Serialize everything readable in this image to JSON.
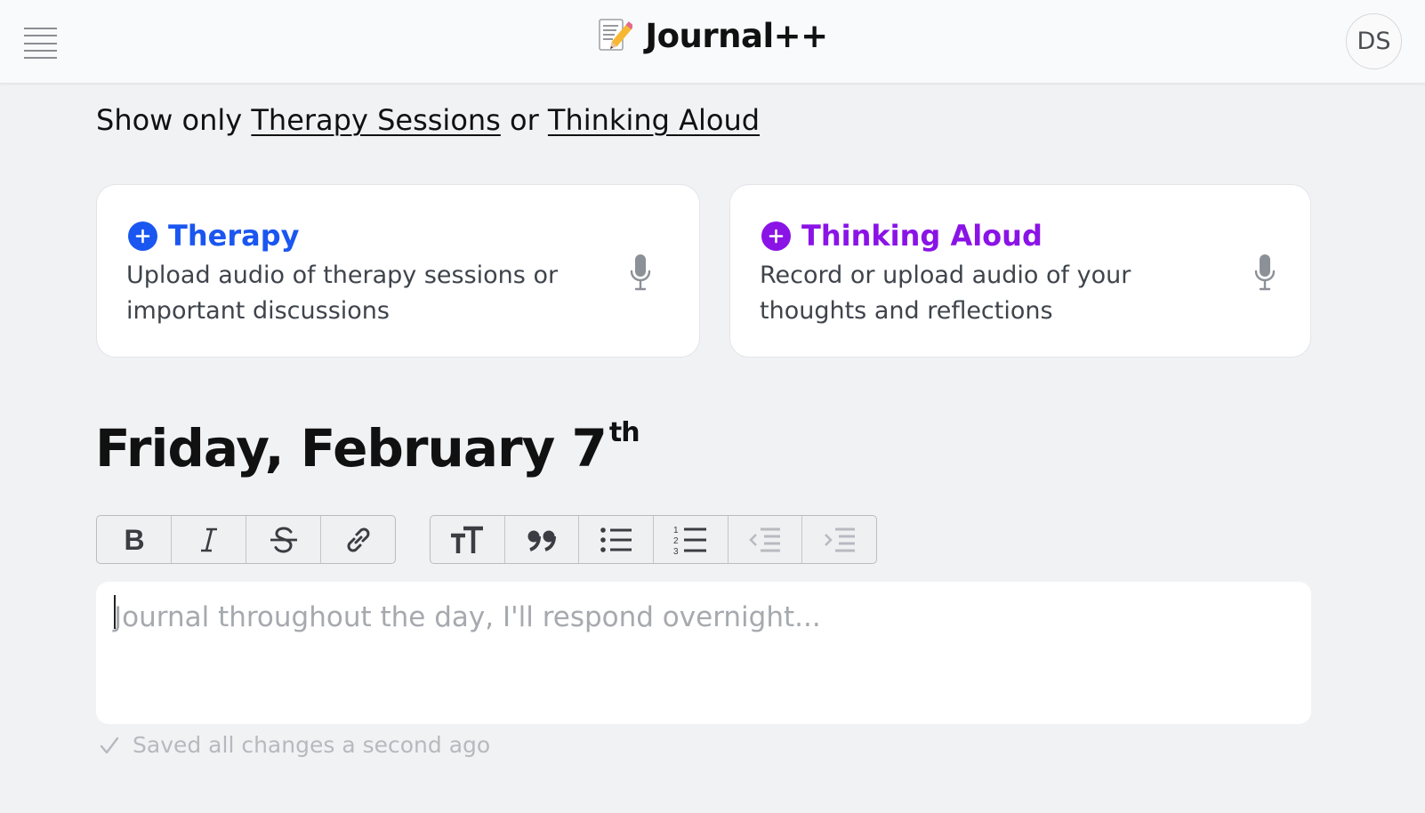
{
  "header": {
    "brand_emoji": "📝",
    "brand_title": "Journal++",
    "avatar_initials": "DS",
    "menu_icon": "hamburger-menu-icon"
  },
  "filter": {
    "prefix": "Show only",
    "link_therapy": "Therapy Sessions",
    "joiner": "or",
    "link_thinking": "Thinking Aloud"
  },
  "cards": [
    {
      "title": "Therapy",
      "description": "Upload audio of therapy sessions or important discussions",
      "accent": "#1a56f0",
      "icons": [
        "plus-circle-icon",
        "microphone-icon"
      ]
    },
    {
      "title": "Thinking Aloud",
      "description": "Record or upload audio of your thoughts and reflections",
      "accent": "#8a13e6",
      "icons": [
        "plus-circle-icon",
        "microphone-icon"
      ]
    }
  ],
  "date": {
    "text": "Friday, February 7",
    "suffix": "th"
  },
  "toolbar": {
    "groups": [
      [
        "bold-icon",
        "italic-icon",
        "strikethrough-icon",
        "link-icon"
      ],
      [
        "heading-icon",
        "quote-icon",
        "bullet-list-icon",
        "numbered-list-icon",
        "outdent-icon",
        "indent-icon"
      ]
    ],
    "disabled": [
      "outdent-icon",
      "indent-icon"
    ]
  },
  "editor": {
    "placeholder": "Journal throughout the day, I'll respond overnight..."
  },
  "status": {
    "saved_text": "Saved all changes a second ago",
    "icon": "checkmark-icon"
  }
}
